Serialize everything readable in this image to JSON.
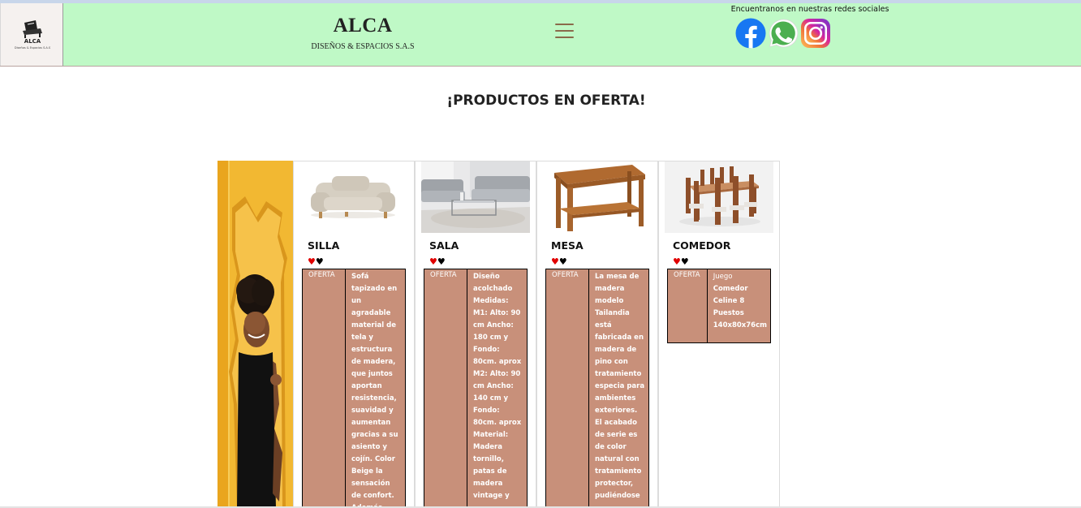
{
  "header": {
    "logo": {
      "text": "ALCA",
      "subtext": "Diseños & Espacios S.A.S"
    },
    "brand_title": "ALCA",
    "brand_subtitle": "DISEÑOS & ESPACIOS S.A.S",
    "menu_icon": "hamburger-icon",
    "social_caption": "Encuentranos en nuestras redes sociales",
    "social": [
      {
        "icon": "facebook-icon",
        "color": "#1877f2"
      },
      {
        "icon": "whatsapp-icon",
        "color": "#4caf50"
      },
      {
        "icon": "instagram-icon",
        "color": "#d6249f"
      }
    ],
    "background": "#bff9c6"
  },
  "main": {
    "section_title": "¡PRODUCTOS EN OFERTA!",
    "products": [
      {
        "name": "SILLA",
        "badge": "OFERTA",
        "description": "Sofá tapizado en un agradable material de tela y estructura de madera, que juntos aportan resistencia, suavidad y aumentan gracias a su asiento y cojín. Color Beige la sensación de confort. Además"
      },
      {
        "name": "SALA",
        "badge": "OFERTA",
        "description": "Diseño acolchado Medidas: M1: Alto: 90 cm Ancho: 180 cm y Fondo: 80cm. aprox M2: Alto: 90 cm Ancho: 140 cm y Fondo: 80cm. aprox Material: Madera tornillo, patas de madera vintage y"
      },
      {
        "name": "MESA",
        "badge": "OFERTA",
        "description": "La mesa de madera modelo Tailandia está fabricada en madera de pino con tratamiento especia para ambientes exteriores. El acabado de serie es de color natural con tratamiento protector, pudiéndose"
      },
      {
        "name": "COMEDOR",
        "badge": "OFERTA",
        "description_prefix": "Juego",
        "description": "Comedor Celine 8 Puestos 140x80x76cm"
      }
    ],
    "colors": {
      "offer_cell": "#c8907a",
      "heart_red": "#e00000",
      "banner": "#f2b832"
    }
  }
}
